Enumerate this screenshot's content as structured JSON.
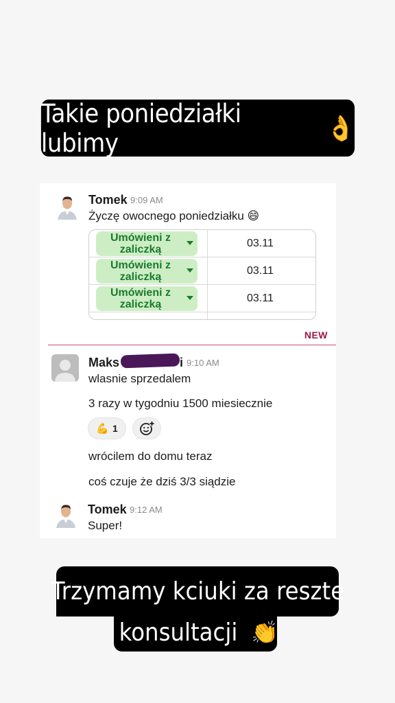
{
  "top_caption": {
    "text": "Takie poniedziałki lubimy",
    "emoji": "👌"
  },
  "bottom_caption": {
    "line1": "Trzymamy kciuki za reszte",
    "line2": "konsultacji",
    "emoji": "👏"
  },
  "messages": [
    {
      "author": "Tomek",
      "time": "9:09 AM",
      "text": "Życzę owocnego poniedziałku 😄"
    },
    {
      "author": "Maks",
      "author_suffix": "i",
      "time": "9:10 AM",
      "lines": [
        "wlasnie sprzedalem",
        "3 razy w tygodniu 1500 miesiecznie",
        "wrócilem do domu teraz",
        "coś czuje że dziś 3/3 siądzie"
      ]
    },
    {
      "author": "Tomek",
      "time": "9:12 AM",
      "text": "Super!"
    }
  ],
  "sheet": {
    "rows": [
      {
        "status_line1": "Umówieni z",
        "status_line2": "zaliczką",
        "date": "03.11"
      },
      {
        "status_line1": "Umówieni z",
        "status_line2": "zaliczką",
        "date": "03.11"
      },
      {
        "status_line1": "Umówieni z",
        "status_line2": "zaliczką",
        "date": "03.11"
      }
    ]
  },
  "new_divider": "NEW",
  "reactions": [
    {
      "emoji": "💪",
      "count": "1"
    }
  ],
  "icons": {
    "add_reaction": "add-reaction-icon"
  },
  "colors": {
    "chip_bg": "#cdeec5",
    "chip_text": "#1b7a2e",
    "new_label": "#9b1a4a",
    "caption_bg": "#000000"
  }
}
